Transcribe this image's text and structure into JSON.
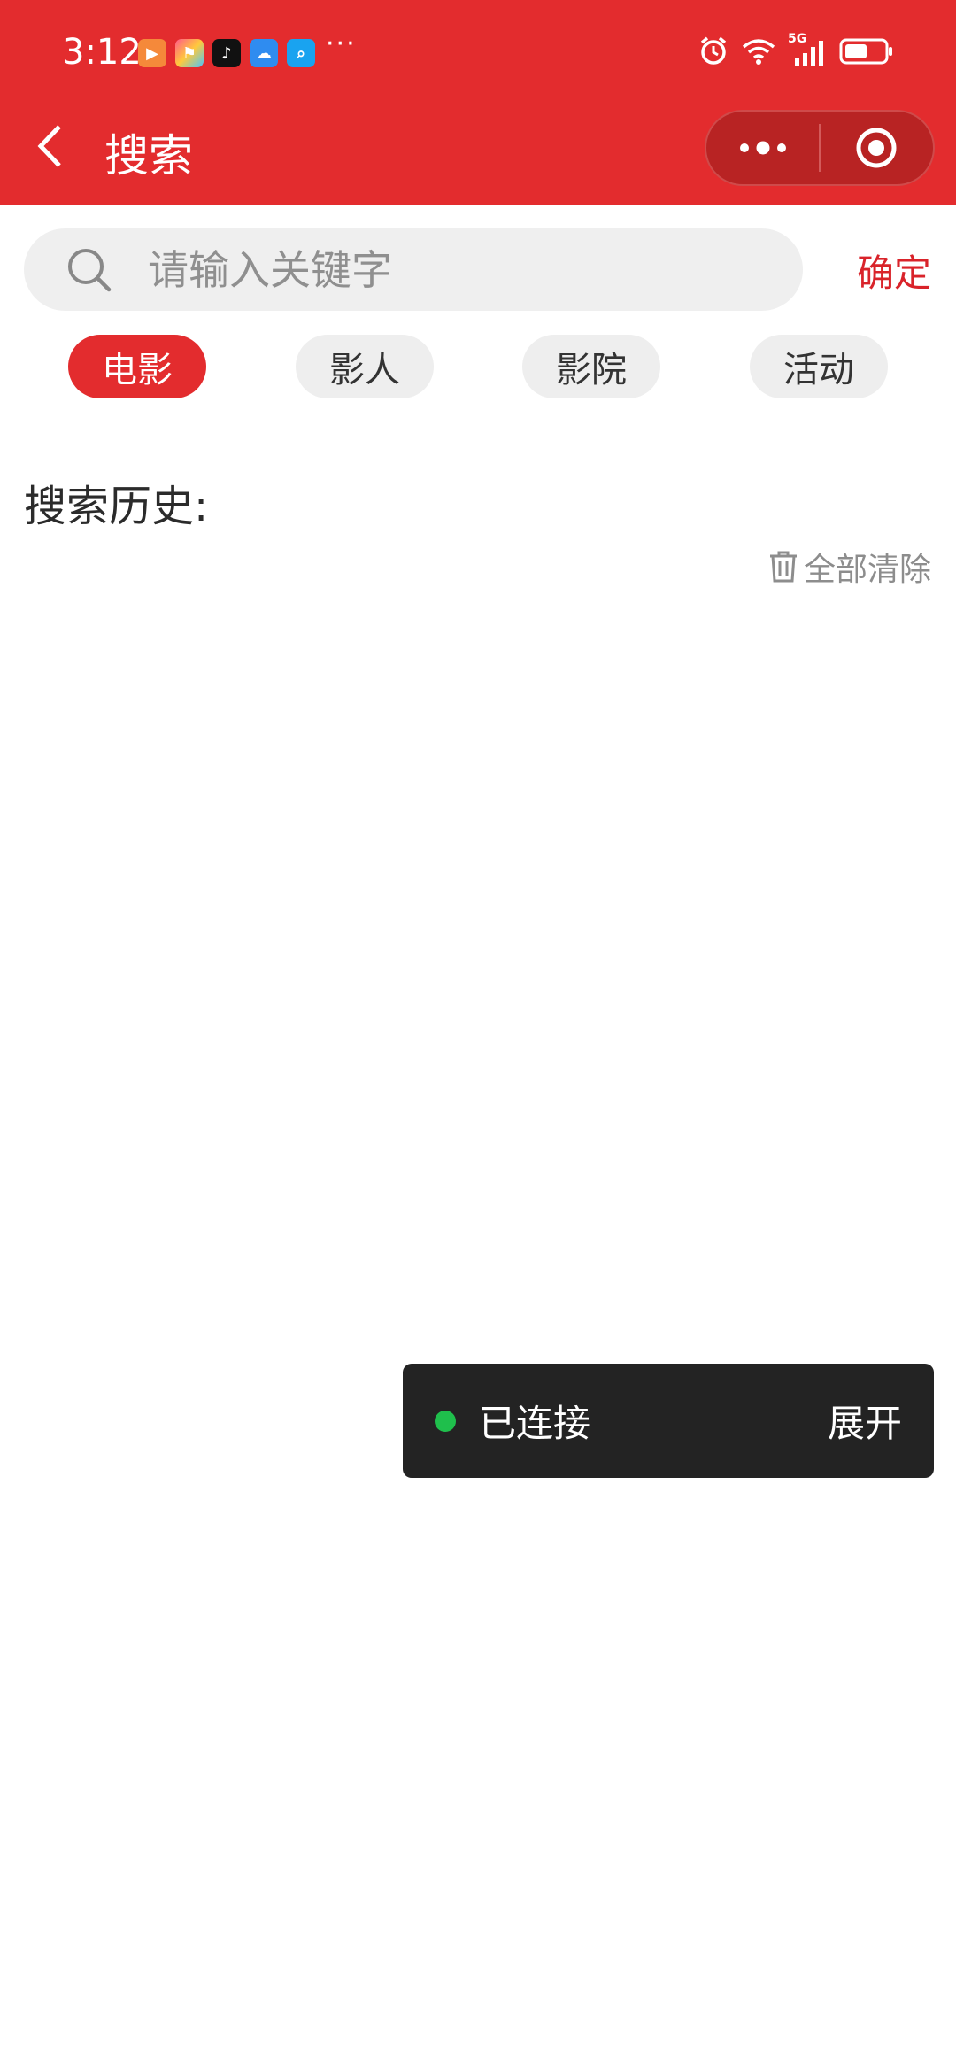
{
  "status_bar": {
    "time": "3:12",
    "more": "···",
    "network": "5G",
    "apps": [
      "video-app-icon",
      "flag-app-icon",
      "tiktok-app-icon",
      "weather-app-icon",
      "search-app-icon"
    ]
  },
  "nav": {
    "title": "搜索"
  },
  "search": {
    "placeholder": "请输入关键字",
    "value": "",
    "confirm_label": "确定"
  },
  "categories": [
    {
      "label": "电影",
      "active": true
    },
    {
      "label": "影人",
      "active": false
    },
    {
      "label": "影院",
      "active": false
    },
    {
      "label": "活动",
      "active": false
    }
  ],
  "history": {
    "title": "搜索历史:",
    "clear_label": "全部清除"
  },
  "toast": {
    "status": "已连接",
    "expand_label": "展开"
  },
  "colors": {
    "brand_red": "#e32c2e",
    "confirm_red": "#d9232a",
    "connected_green": "#1fbf4c"
  }
}
